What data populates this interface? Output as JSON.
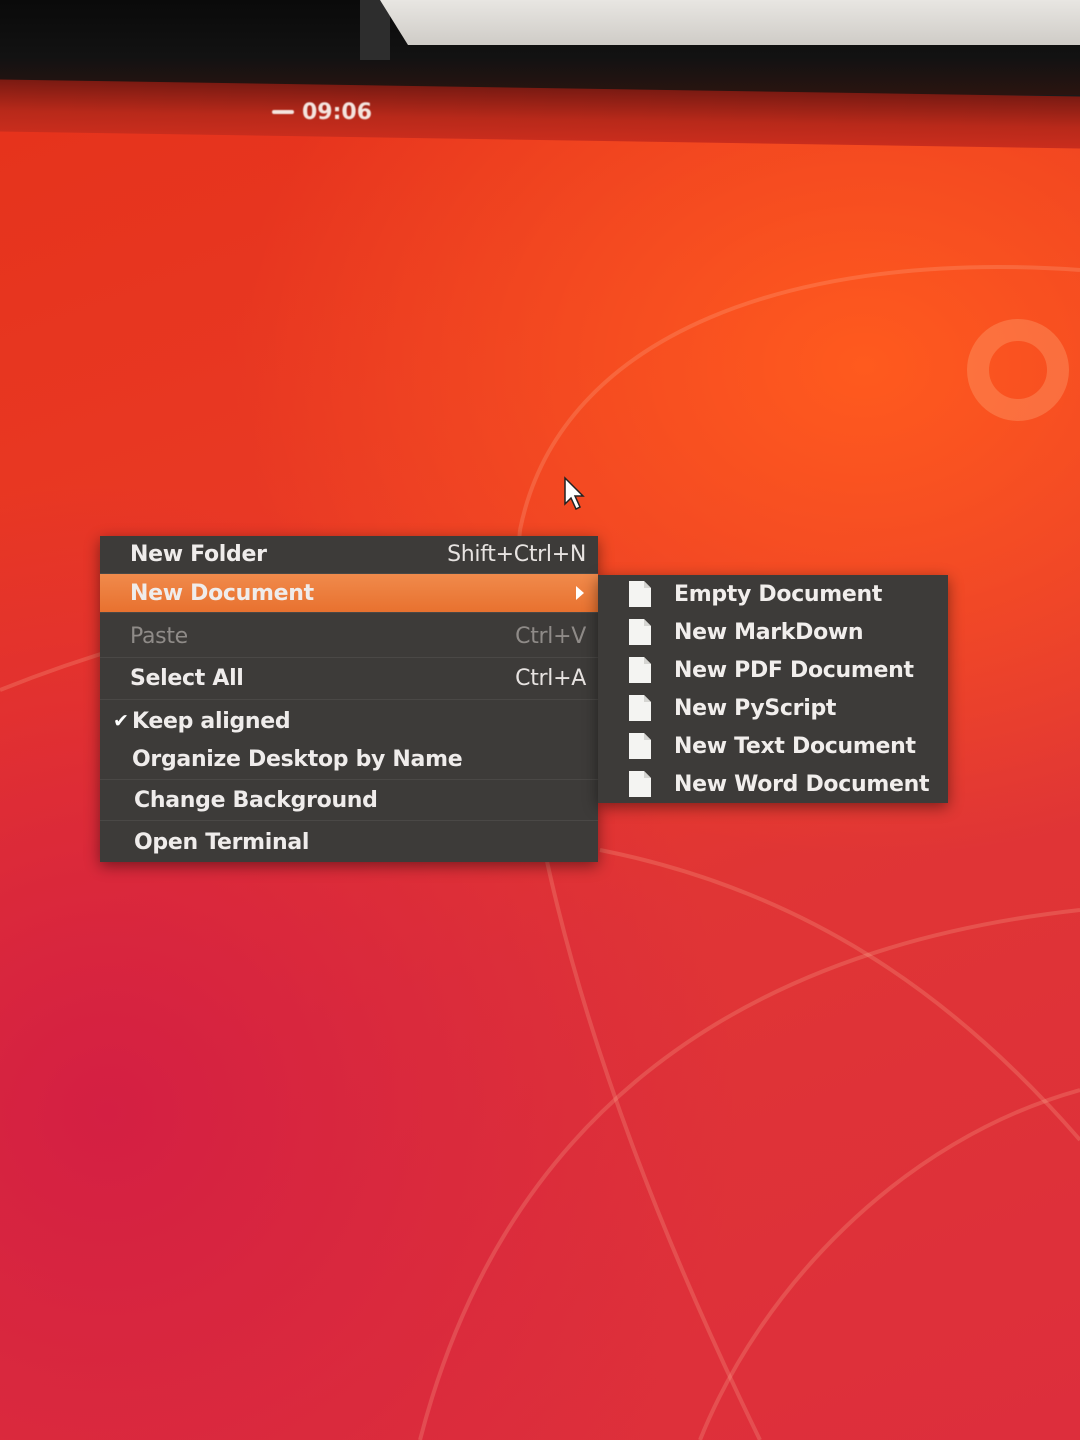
{
  "panel": {
    "clock": "09:06"
  },
  "context_menu": {
    "items": [
      {
        "label": "New Folder",
        "accel": "Shift+Ctrl+N"
      },
      {
        "label": "New Document",
        "accel": ""
      },
      {
        "label": "Paste",
        "accel": "Ctrl+V"
      },
      {
        "label": "Select All",
        "accel": "Ctrl+A"
      },
      {
        "label": "Keep aligned",
        "accel": ""
      },
      {
        "label": "Organize Desktop by Name",
        "accel": ""
      },
      {
        "label": "Change Background",
        "accel": ""
      },
      {
        "label": "Open Terminal",
        "accel": ""
      }
    ]
  },
  "submenu": {
    "items": [
      {
        "label": "Empty Document",
        "icon": "document-icon"
      },
      {
        "label": "New MarkDown",
        "icon": "document-icon"
      },
      {
        "label": "New PDF Document",
        "icon": "document-icon"
      },
      {
        "label": "New PyScript",
        "icon": "document-icon"
      },
      {
        "label": "New Text Document",
        "icon": "document-icon"
      },
      {
        "label": "New Word Document",
        "icon": "document-icon"
      }
    ]
  },
  "colors": {
    "highlight": "#e8712f",
    "menu_bg": "#3d3b39",
    "wallpaper_orange": "#e6331c",
    "wallpaper_magenta": "#d41f43"
  }
}
